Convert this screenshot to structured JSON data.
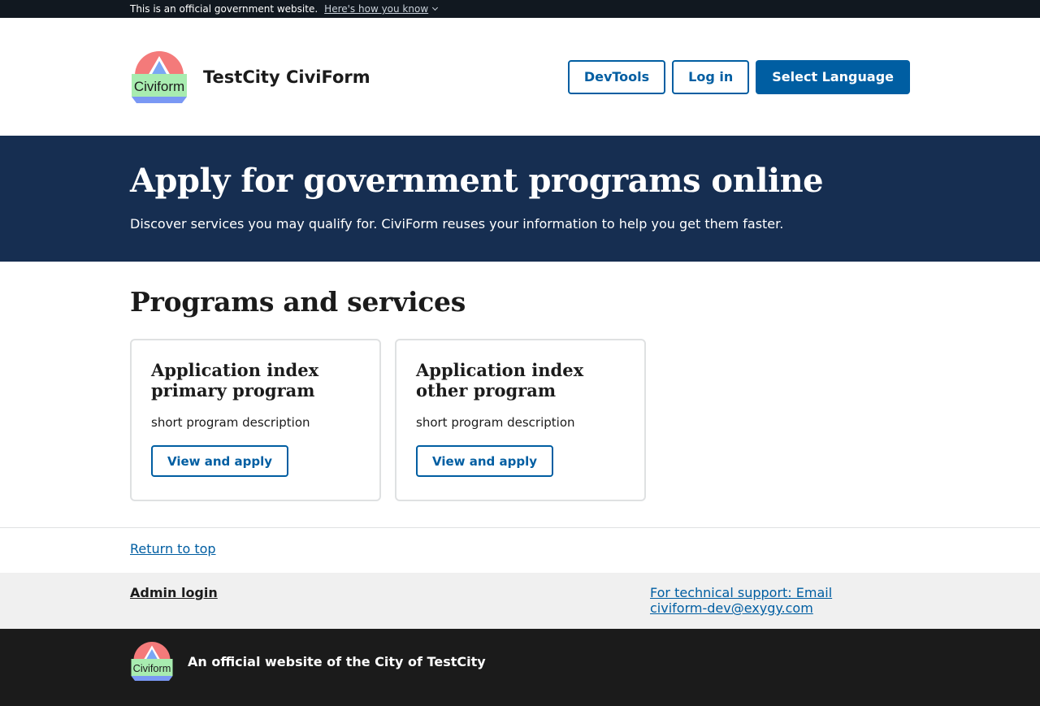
{
  "gov_banner": {
    "text": "This is an official government website.",
    "how_link": "Here's how you know"
  },
  "header": {
    "logo_text": "Civiform",
    "title": "TestCity CiviForm",
    "devtools_label": "DevTools",
    "login_label": "Log in",
    "language_label": "Select Language"
  },
  "hero": {
    "title": "Apply for government programs online",
    "subtitle": "Discover services you may qualify for. CiviForm reuses your information to help you get them faster."
  },
  "programs": {
    "heading": "Programs and services",
    "cards": [
      {
        "title": "Application index primary program",
        "description": "short program description",
        "button": "View and apply"
      },
      {
        "title": "Application index other program",
        "description": "short program description",
        "button": "View and apply"
      }
    ]
  },
  "footer": {
    "return_to_top": "Return to top",
    "admin_login": "Admin login",
    "support": "For technical support: Email civiform-dev@exygy.com",
    "official": "An official website of the City of TestCity",
    "logo_text": "Civiform"
  },
  "colors": {
    "primary": "#005ea2",
    "hero_bg": "#162e51",
    "banner_bg": "#111820",
    "footer_bg": "#1b1b1b",
    "footer_secondary_bg": "#f0f0f0"
  }
}
